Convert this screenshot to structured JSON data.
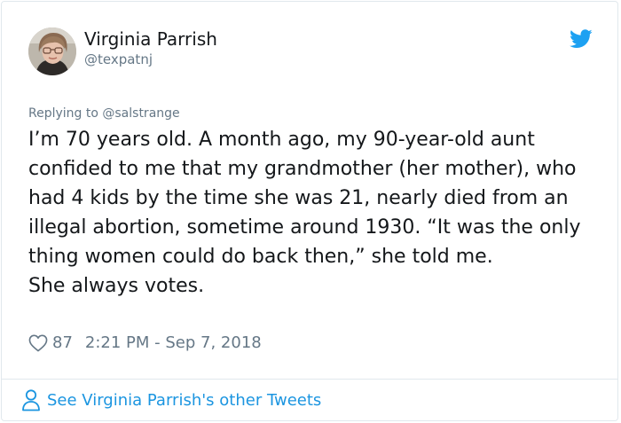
{
  "tweet": {
    "author_name": "Virginia Parrish",
    "author_handle": "@texpatnj",
    "reply_prefix": "Replying to ",
    "reply_to": "@salstrange",
    "text_paragraph_1": "I’m 70 years old. A month ago, my 90-year-old aunt confided to me that my grandmother (her mother), who had 4 kids by the time she was 21, nearly died from an illegal abortion, sometime around 1930. “It was the only thing women could do back then,” she told me.",
    "text_paragraph_2": "She always votes.",
    "likes": "87",
    "timestamp": "2:21 PM - Sep 7, 2018"
  },
  "footer": {
    "link_text": "See Virginia Parrish's other Tweets"
  },
  "icons": {
    "brand": "twitter-bird-icon",
    "like": "heart-icon",
    "footer": "person-icon"
  },
  "colors": {
    "twitter_blue": "#1da1f2",
    "link_blue": "#1b95e0",
    "secondary_text": "#657786",
    "border": "#e1e8ed"
  }
}
